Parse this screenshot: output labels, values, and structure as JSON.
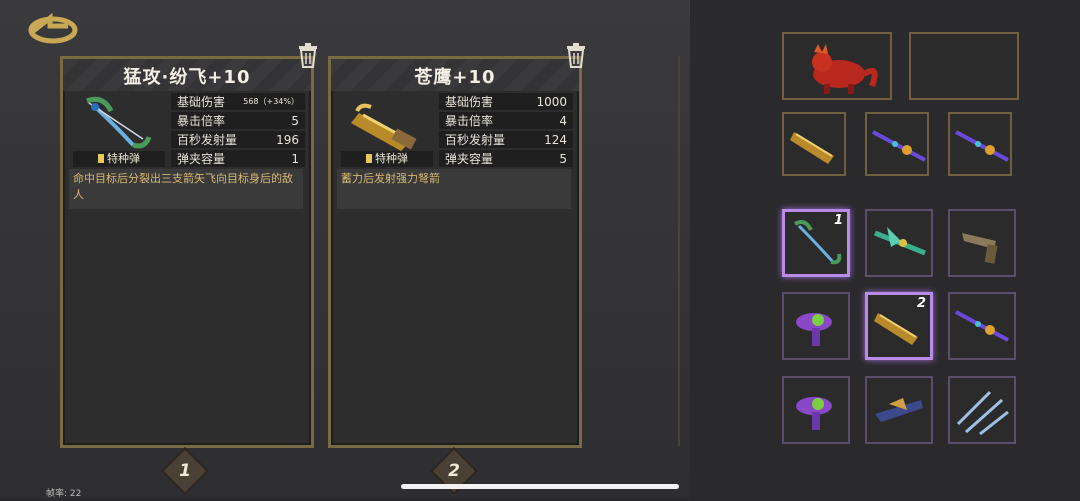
{
  "cards": [
    {
      "title": "猛攻·纷飞+10",
      "ammo": "特种弹",
      "stats": [
        {
          "label": "基础伤害",
          "value": "568（+34%）"
        },
        {
          "label": "暴击倍率",
          "value": "5"
        },
        {
          "label": "百秒发射量",
          "value": "196"
        },
        {
          "label": "弹夹容量",
          "value": "1"
        }
      ],
      "description": "命中目标后分裂出三支箭矢飞向目标身后的敌人",
      "badge": "1"
    },
    {
      "title": "苍鹰+10",
      "ammo": "特种弹",
      "stats": [
        {
          "label": "基础伤害",
          "value": "1000"
        },
        {
          "label": "暴击倍率",
          "value": "4"
        },
        {
          "label": "百秒发射量",
          "value": "124"
        },
        {
          "label": "弹夹容量",
          "value": "5"
        }
      ],
      "description": "蓄力后发射强力弩箭",
      "badge": "2"
    }
  ],
  "inventory": {
    "selected_1": "1",
    "selected_2": "2"
  },
  "fps_label": "帧率: 22",
  "icons": {
    "back": "back-arrow-icon",
    "trash": "trash-icon"
  }
}
